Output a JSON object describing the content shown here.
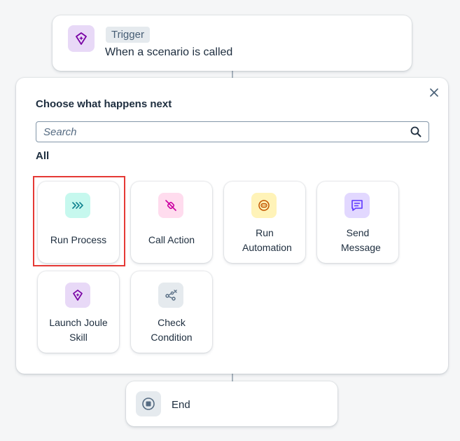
{
  "trigger": {
    "badge": "Trigger",
    "description": "When a scenario is called",
    "icon": "diamond-sparkle-icon"
  },
  "panel": {
    "title": "Choose what happens next",
    "close_icon": "close-icon",
    "search": {
      "placeholder": "Search",
      "value": ""
    },
    "section_label": "All",
    "tiles": [
      {
        "label": "Run Process",
        "icon": "run-process-icon",
        "icon_bg": "#c6f8ee",
        "icon_color": "#0f828f",
        "selected": true
      },
      {
        "label": "Call Action",
        "icon": "call-action-icon",
        "icon_bg": "#ffdcee",
        "icon_color": "#cc00a1"
      },
      {
        "label": "Run Automation",
        "icon": "automation-icon",
        "icon_bg": "#fff3b8",
        "icon_color": "#c35500"
      },
      {
        "label": "Send Message",
        "icon": "message-icon",
        "icon_bg": "#e2d8ff",
        "icon_color": "#5d36ff"
      },
      {
        "label": "Launch Joule Skill",
        "icon": "joule-skill-icon",
        "icon_bg": "#e8d9f7",
        "icon_color": "#7800a4"
      },
      {
        "label": "Check Condition",
        "icon": "condition-icon",
        "icon_bg": "#e5eaee",
        "icon_color": "#556b82"
      }
    ]
  },
  "end": {
    "label": "End",
    "icon": "stop-icon"
  },
  "colors": {
    "selection_outline": "#e53935",
    "text": "#1d2d3e"
  }
}
